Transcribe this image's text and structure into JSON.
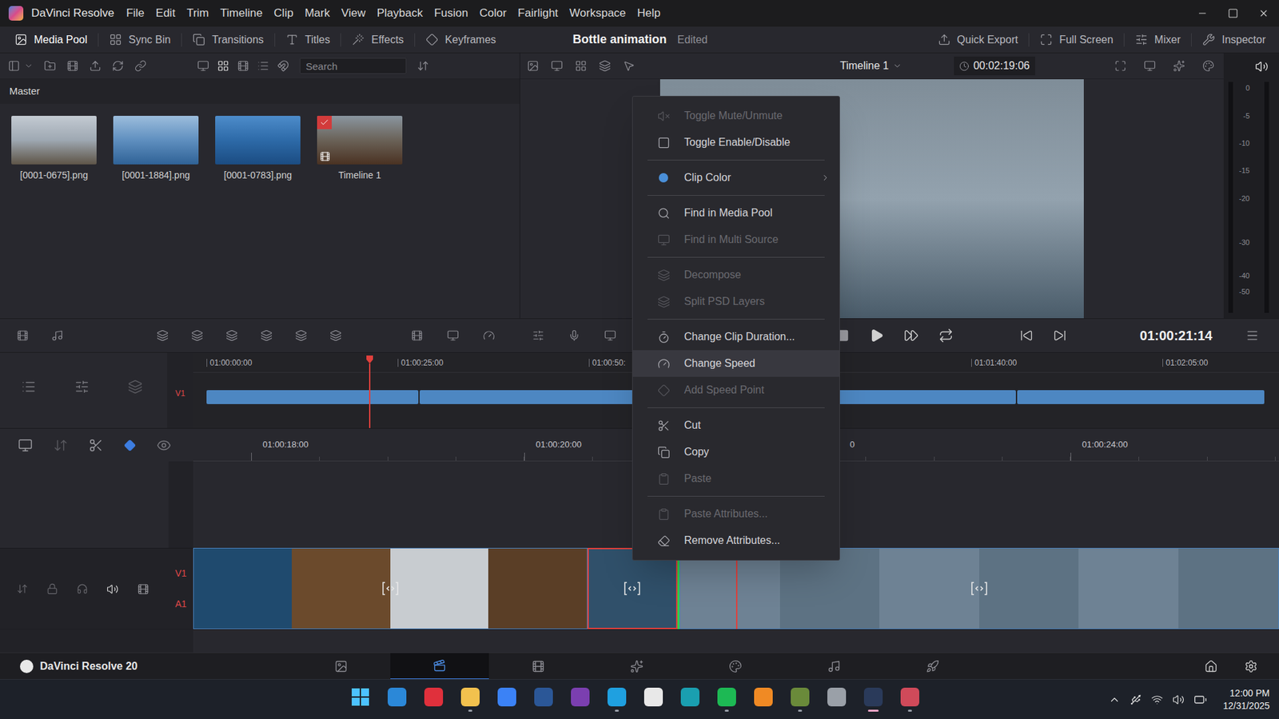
{
  "app": {
    "name": "DaVinci Resolve"
  },
  "menu": [
    "File",
    "Edit",
    "Trim",
    "Timeline",
    "Clip",
    "Mark",
    "View",
    "Playback",
    "Fusion",
    "Color",
    "Fairlight",
    "Workspace",
    "Help"
  ],
  "toolbar": {
    "left": [
      {
        "label": "Media Pool",
        "selected": true
      },
      {
        "label": "Sync Bin",
        "selected": false
      },
      {
        "label": "Transitions",
        "selected": false
      },
      {
        "label": "Titles",
        "selected": false
      },
      {
        "label": "Effects",
        "selected": false
      },
      {
        "label": "Keyframes",
        "selected": false
      }
    ],
    "project": "Bottle animation",
    "status": "Edited",
    "right": [
      {
        "label": "Quick Export",
        "selected": false
      },
      {
        "label": "Full Screen",
        "selected": false
      },
      {
        "label": "Mixer",
        "selected": false
      },
      {
        "label": "Inspector",
        "selected": false
      }
    ]
  },
  "media_pool": {
    "search": {
      "placeholder": "Search"
    },
    "bin": "Master",
    "items": [
      {
        "name": "[0001-0675].png",
        "kind": "image",
        "in_use": false
      },
      {
        "name": "[0001-1884].png",
        "kind": "image",
        "in_use": false
      },
      {
        "name": "[0001-0783].png",
        "kind": "image",
        "in_use": false
      },
      {
        "name": "Timeline 1",
        "kind": "timeline",
        "in_use": true
      }
    ]
  },
  "viewer": {
    "timeline": "Timeline 1",
    "duration": "00:02:19:06",
    "timecode": "01:00:21:14"
  },
  "audio_meter": {
    "ticks": [
      "0",
      "-5",
      "-10",
      "-15",
      "-20",
      "-30",
      "-40",
      "-50"
    ]
  },
  "mini_timeline": {
    "track": "V1",
    "ticks": [
      "01:00:00:00",
      "01:00:25:00",
      "01:00:50:",
      "01:01:40:00",
      "01:02:05:00"
    ],
    "playhead": 0.154,
    "clips": [
      {
        "share": 0.2
      },
      {
        "share": 0.562
      },
      {
        "share": 0.233
      }
    ]
  },
  "timeline": {
    "tracks": [
      {
        "label": "V1"
      },
      {
        "label": "A1"
      }
    ],
    "ticks": [
      "01:00:18:00",
      "01:00:20:00",
      "0",
      "01:00:24:00"
    ],
    "playhead": 0.5,
    "clips": [
      {
        "share": 0.363,
        "selected": false
      },
      {
        "share": 0.083,
        "selected": true
      },
      {
        "share": 0.552,
        "selected": false
      }
    ]
  },
  "context_menu": {
    "groups": [
      [
        {
          "label": "Toggle Mute/Unmute",
          "disabled": true,
          "selected": false,
          "submenu": false
        },
        {
          "label": "Toggle Enable/Disable",
          "disabled": false,
          "selected": false,
          "submenu": false
        }
      ],
      [
        {
          "label": "Clip Color",
          "disabled": false,
          "selected": false,
          "submenu": true,
          "color": "#4a8fd8"
        }
      ],
      [
        {
          "label": "Find in Media Pool",
          "disabled": false,
          "selected": false,
          "submenu": false
        },
        {
          "label": "Find in Multi Source",
          "disabled": true,
          "selected": false,
          "submenu": false
        }
      ],
      [
        {
          "label": "Decompose",
          "disabled": true,
          "selected": false,
          "submenu": false
        },
        {
          "label": "Split PSD Layers",
          "disabled": true,
          "selected": false,
          "submenu": false
        }
      ],
      [
        {
          "label": "Change Clip Duration...",
          "disabled": false,
          "selected": false,
          "submenu": false
        },
        {
          "label": "Change Speed",
          "disabled": false,
          "selected": true,
          "submenu": false
        },
        {
          "label": "Add Speed Point",
          "disabled": true,
          "selected": false,
          "submenu": false
        }
      ],
      [
        {
          "label": "Cut",
          "disabled": false,
          "selected": false,
          "submenu": false
        },
        {
          "label": "Copy",
          "disabled": false,
          "selected": false,
          "submenu": false
        },
        {
          "label": "Paste",
          "disabled": true,
          "selected": false,
          "submenu": false
        }
      ],
      [
        {
          "label": "Paste Attributes...",
          "disabled": true,
          "selected": false,
          "submenu": false
        },
        {
          "label": "Remove Attributes...",
          "disabled": false,
          "selected": false,
          "submenu": false
        }
      ]
    ]
  },
  "pages": {
    "brand": "DaVinci Resolve 20",
    "items": [
      {
        "kind": "media",
        "selected": false
      },
      {
        "kind": "cut",
        "selected": true
      },
      {
        "kind": "edit",
        "selected": false
      },
      {
        "kind": "fusion",
        "selected": false
      },
      {
        "kind": "color",
        "selected": false
      },
      {
        "kind": "fairlight",
        "selected": false
      },
      {
        "kind": "deliver",
        "selected": false
      }
    ]
  },
  "taskbar": {
    "apps": [
      {
        "kind": "start",
        "color": "#4cc2ff",
        "running": false,
        "selected": false
      },
      {
        "kind": "app",
        "color": "#2b88d8",
        "running": false,
        "selected": false
      },
      {
        "kind": "app",
        "color": "#e0303c",
        "running": false,
        "selected": false
      },
      {
        "kind": "app",
        "color": "#f2c14e",
        "running": true,
        "selected": false
      },
      {
        "kind": "app",
        "color": "#3b82f6",
        "running": false,
        "selected": false
      },
      {
        "kind": "app",
        "color": "#2b5797",
        "running": false,
        "selected": false
      },
      {
        "kind": "app",
        "color": "#7b3fb0",
        "running": false,
        "selected": false
      },
      {
        "kind": "app",
        "color": "#1fa0e0",
        "running": true,
        "selected": false
      },
      {
        "kind": "app",
        "color": "#e8e8e8",
        "running": false,
        "selected": false
      },
      {
        "kind": "app",
        "color": "#1a9fb0",
        "running": false,
        "selected": false
      },
      {
        "kind": "app",
        "color": "#1db954",
        "running": true,
        "selected": false
      },
      {
        "kind": "app",
        "color": "#f08a24",
        "running": false,
        "selected": false
      },
      {
        "kind": "app",
        "color": "#6a8a3a",
        "running": true,
        "selected": false
      },
      {
        "kind": "app",
        "color": "#9aa0a8",
        "running": false,
        "selected": false
      },
      {
        "kind": "app",
        "color": "#2a3a5a",
        "running": true,
        "selected": true
      },
      {
        "kind": "app",
        "color": "#d04a5a",
        "running": true,
        "selected": false
      }
    ],
    "time": "12:00 PM",
    "date": "12/31/2025"
  }
}
